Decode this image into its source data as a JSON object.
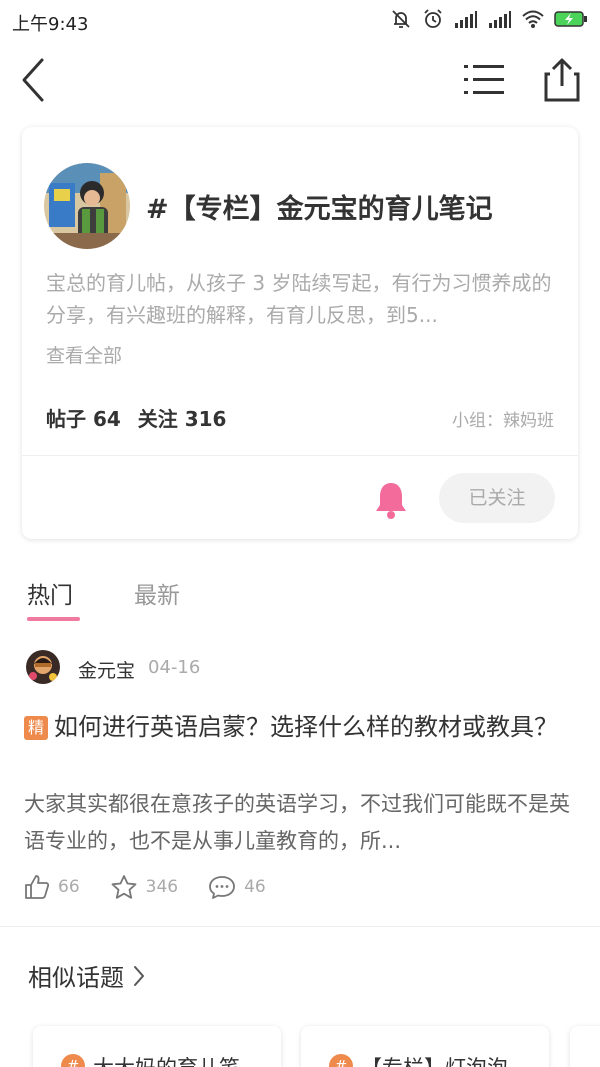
{
  "status_bar": {
    "time": "上午9:43",
    "icons": [
      "mute-icon",
      "alarm-icon",
      "signal-icon",
      "signal-icon",
      "wifi-icon",
      "battery-charging-icon"
    ]
  },
  "nav": {
    "back_icon": "chevron-left-icon",
    "menu_icon": "list-menu-icon",
    "share_icon": "share-icon"
  },
  "topic": {
    "title": "#【专栏】金元宝的育儿笔记",
    "description": "宝总的育儿帖，从孩子 3 岁陆续写起，有行为习惯养成的分享，有兴趣班的解释，有育儿反思，到5...",
    "view_all": "查看全部",
    "posts_label": "帖子 64",
    "follows_label": "关注 316",
    "group": "小组：辣妈班",
    "follow_button": "已关注",
    "bell_color": "#f36b9a"
  },
  "tabs": [
    {
      "label": "热门",
      "active": true
    },
    {
      "label": "最新",
      "active": false
    }
  ],
  "post": {
    "author": "金元宝",
    "date": "04-16",
    "badge": "精",
    "title": "如何进行英语启蒙？选择什么样的教材或教具？",
    "summary": "大家其实都很在意孩子的英语学习，不过我们可能既不是英语专业的，也不是从事儿童教育的，所...",
    "likes": "66",
    "favorites": "346",
    "comments": "46"
  },
  "similar": {
    "title": "相似话题",
    "cards": [
      {
        "label": "大大妈的育儿笔"
      },
      {
        "label": "【专栏】灯泡泡"
      },
      {
        "label": ""
      }
    ]
  },
  "colors": {
    "accent_pink": "#f07aa0",
    "badge_orange": "#ee8a4c"
  }
}
